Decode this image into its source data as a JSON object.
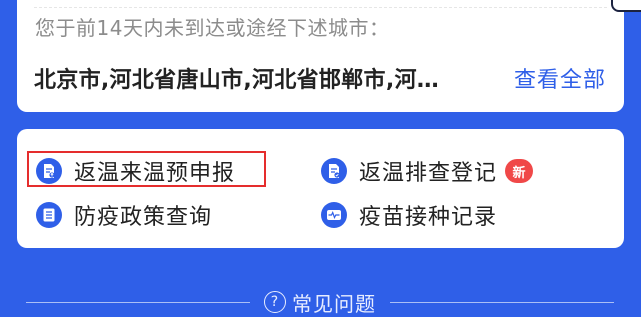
{
  "travel_notice": {
    "heading": "您于前14天内未到达或途经下述城市：",
    "cities": "北京市,河北省唐山市,河北省邯郸市,河…",
    "view_all_label": "查看全部"
  },
  "menu": {
    "items": [
      {
        "label": "返温来温预申报",
        "icon": "document-upload-icon"
      },
      {
        "label": "返温排查登记",
        "icon": "document-check-icon",
        "badge": "新"
      },
      {
        "label": "防疫政策查询",
        "icon": "list-icon"
      },
      {
        "label": "疫苗接种记录",
        "icon": "pulse-card-icon"
      }
    ]
  },
  "faq": {
    "label": "常见问题",
    "icon_glyph": "?"
  },
  "colors": {
    "brand_blue": "#2f5fe8",
    "badge_red": "#f04848",
    "highlight_red": "#e52d2d"
  }
}
